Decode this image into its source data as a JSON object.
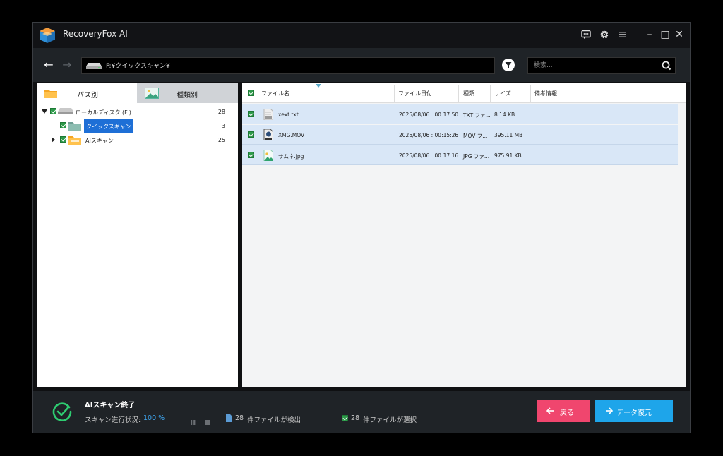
{
  "app": {
    "title": "RecoveryFox AI"
  },
  "titlebar": {
    "feedback_icon": "chat-icon",
    "settings_icon": "gear-icon",
    "menu_icon": "hamburger-icon",
    "minimize": "–",
    "maximize": "□",
    "close": "✕"
  },
  "toolbar": {
    "back": "←",
    "forward": "→",
    "path": "F:¥クイックスキャン¥",
    "search_placeholder": "検索..."
  },
  "left_tabs": [
    {
      "label": "パス別"
    },
    {
      "label": "種類別"
    }
  ],
  "tree": [
    {
      "label": "ローカルディスク (F:)",
      "count": "28"
    },
    {
      "label": "クイックスキャン",
      "count": "3"
    },
    {
      "label": "AIスキャン",
      "count": "25"
    }
  ],
  "list_headers": {
    "name": "ファイル名",
    "date": "ファイル日付",
    "type": "種類",
    "size": "サイズ",
    "note": "備考情報"
  },
  "files": [
    {
      "name": "xext.txt",
      "date": "2025/08/06 : 00:17:50",
      "type": "TXT ファ...",
      "size": "8.14 KB"
    },
    {
      "name": "XMG.MOV",
      "date": "2025/08/06 : 00:15:26",
      "type": "MOV フ...",
      "size": "395.11 MB"
    },
    {
      "name": "サムネ.jpg",
      "date": "2025/08/06 : 00:17:16",
      "type": "JPG ファ...",
      "size": "975.91 KB"
    }
  ],
  "status": {
    "title": "AIスキャン終了",
    "progress_label": "スキャン進行状況:",
    "progress_value": "100 %",
    "found_count": "28",
    "found_text": "件ファイルが検出",
    "selected_count": "28",
    "selected_text": "件ファイルが選択"
  },
  "buttons": {
    "back": "戻る",
    "recover": "データ復元"
  },
  "colors": {
    "accent_blue": "#1ea5ea",
    "accent_pink": "#f0466e",
    "check_green": "#2e9a4a",
    "progress_blue": "#3fa9f5"
  }
}
